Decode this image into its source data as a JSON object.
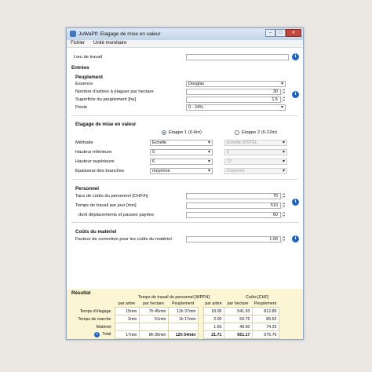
{
  "window": {
    "title": "JuWaPfl: Elagage de mise en valeur"
  },
  "menu": {
    "items": [
      "Fichier",
      "Unité monétaire"
    ]
  },
  "lieu": {
    "label": "Lieu de travail",
    "value": ""
  },
  "entrees": {
    "header": "Entrées"
  },
  "peuplement": {
    "header": "Peuplement",
    "essence": {
      "label": "Essence",
      "value": "Douglas"
    },
    "nombre": {
      "label": "Nombre d'arbres  à élaguer par hectare",
      "value": "30"
    },
    "superficie": {
      "label": "Superficie du peuplement [ha]",
      "value": "1.5"
    },
    "pente": {
      "label": "Pente",
      "value": "0 - 24%"
    }
  },
  "elagage": {
    "header": "Elagage de mise en valeur",
    "etape1": "Etappe 1 (0-6m)",
    "etape2": "Etappe 2 (6-12m)",
    "methode": {
      "label": "Méthode",
      "value": "Echelle",
      "value2": "Echelle DISTEL"
    },
    "hinf": {
      "label": "Hauteur inférieure",
      "value": "0",
      "value2": "6"
    },
    "hsup": {
      "label": "Hauteur supérieure",
      "value": "6",
      "value2": "12"
    },
    "epaisseur": {
      "label": "Epaisseur des branches",
      "value": "moyenne",
      "value2": "moyenne"
    }
  },
  "personnel": {
    "header": "Personnel",
    "taux": {
      "label": "Taux de coûts du personnel [CHF/h]",
      "value": "70"
    },
    "temps": {
      "label": "Temps de travail par jour  [min]",
      "value": "510"
    },
    "pauses": {
      "label": "dont déplacements et pauses payées",
      "value": "60"
    }
  },
  "materiel": {
    "header": "Coûts du matériel",
    "facteur": {
      "label": "Facteur de correction pour les coûts du matériel",
      "value": "1.00"
    }
  },
  "resultat": {
    "header": "Résultat",
    "group1": "Temps de travail du personnel [WPPH]",
    "group2": "Coûts [CHF]",
    "cols": [
      "par arbre",
      "par hectare",
      "Peuplement",
      "par arbre",
      "par hectare",
      "Peuplement"
    ],
    "rows": [
      {
        "label": "Temps d'élagage",
        "cells": [
          "15min",
          "7h 45min",
          "11h 37min",
          "18.06",
          "541.93",
          "812.89"
        ]
      },
      {
        "label": "Temps de marche",
        "cells": [
          "2min",
          "51min",
          "1h 17min",
          "2.00",
          "59.75",
          "89.62"
        ]
      },
      {
        "label": "Matériel",
        "cells": [
          "",
          "",
          "",
          "1.65",
          "49.50",
          "74.25"
        ]
      },
      {
        "label": "Total",
        "cells": [
          "17min",
          "8h 36min",
          "12h 54min",
          "21.71",
          "651.17",
          "976.76"
        ]
      }
    ]
  },
  "colors": {
    "accent": "#1d64c8",
    "results_bg": "#fbf5d3"
  }
}
